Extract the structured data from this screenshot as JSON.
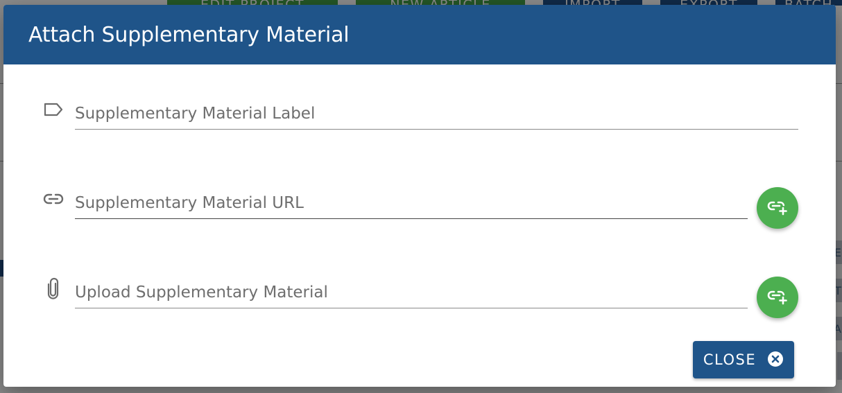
{
  "background": {
    "toolbar_buttons": [
      {
        "label": "EDIT PROJECT"
      },
      {
        "label": "NEW ARTICLE"
      },
      {
        "label": "IMPORT"
      },
      {
        "label": "EXPORT"
      },
      {
        "label": "BATCH"
      }
    ],
    "edge_tabs": [
      "E",
      "T",
      "A"
    ]
  },
  "dialog": {
    "title": "Attach Supplementary Material",
    "fields": {
      "label": {
        "placeholder": "Supplementary Material Label",
        "value": "",
        "icon": "label-icon"
      },
      "url": {
        "placeholder": "Supplementary Material URL",
        "value": "",
        "icon": "link-icon",
        "action_icon": "add-link-icon"
      },
      "upload": {
        "placeholder": "Upload Supplementary Material",
        "value": "",
        "icon": "paperclip-icon",
        "action_icon": "add-link-icon"
      }
    },
    "close_button": {
      "label": "CLOSE",
      "icon": "close-circle-icon"
    }
  },
  "colors": {
    "header": "#1f5489",
    "fab": "#4caf50",
    "close_button": "#1f5489"
  }
}
